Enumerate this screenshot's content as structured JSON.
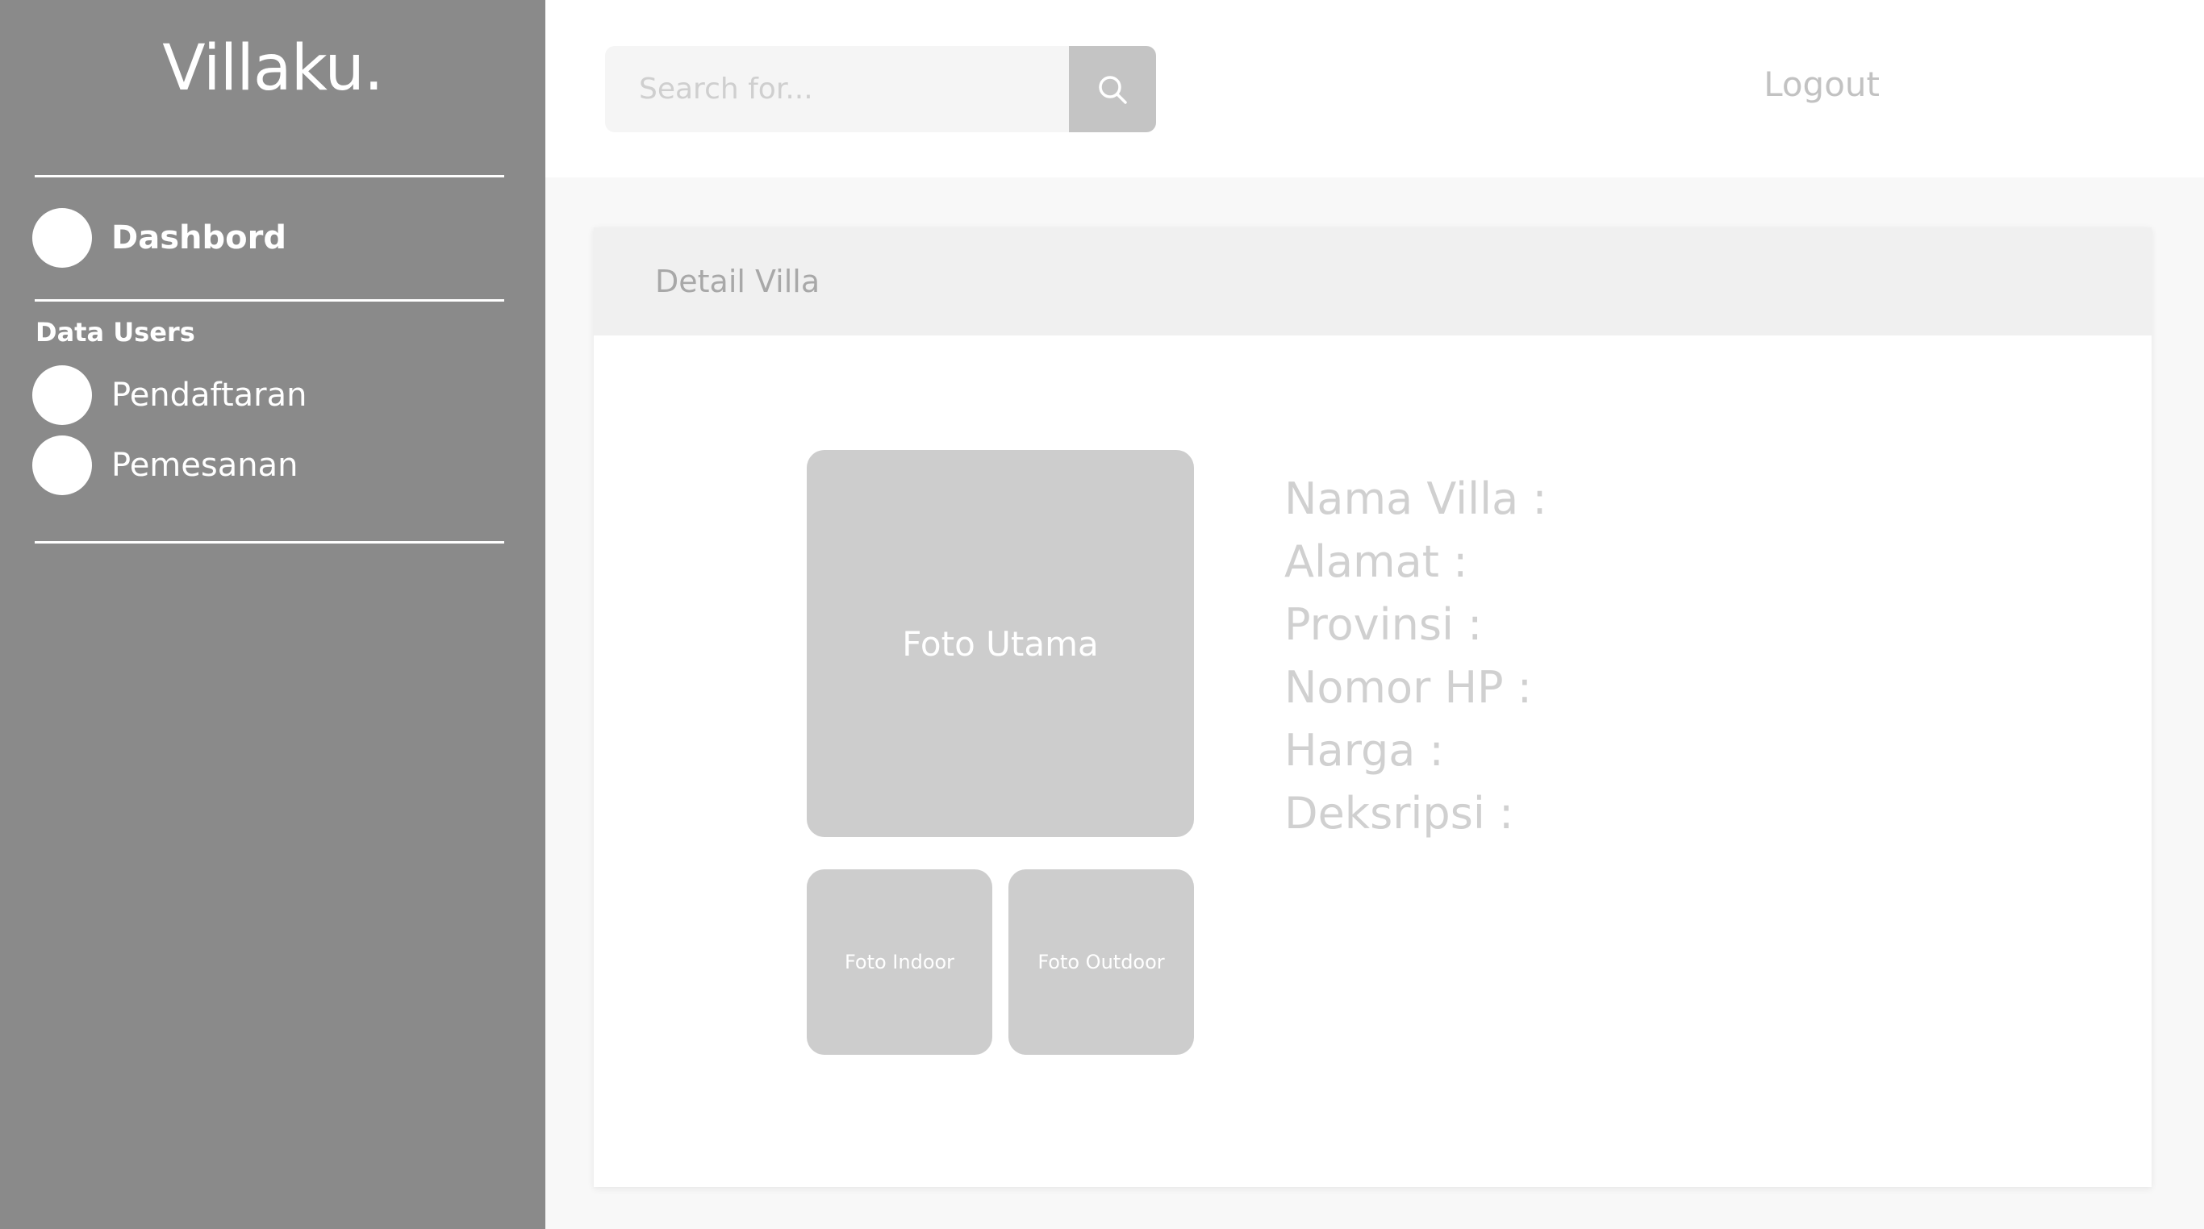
{
  "sidebar": {
    "brand": "Villaku.",
    "dashboard_label": "Dashbord",
    "section_label": "Data Users",
    "items": [
      {
        "label": "Pendaftaran"
      },
      {
        "label": "Pemesanan"
      }
    ]
  },
  "header": {
    "search_placeholder": "Search for...",
    "search_icon": "search-icon",
    "logout_label": "Logout"
  },
  "main": {
    "card_title": "Detail Villa",
    "photos": {
      "main": "Foto Utama",
      "indoor": "Foto Indoor",
      "outdoor": "Foto Outdoor"
    },
    "fields": [
      {
        "label": "Nama Villa :"
      },
      {
        "label": "Alamat :"
      },
      {
        "label": "Provinsi :"
      },
      {
        "label": "Nomor HP :"
      },
      {
        "label": "Harga :"
      },
      {
        "label": "Deksripsi :"
      }
    ]
  },
  "colors": {
    "sidebar_bg": "#8a8a8a",
    "placeholder_gray": "#cdcdcd",
    "card_header_bg": "#f0f0f0"
  }
}
